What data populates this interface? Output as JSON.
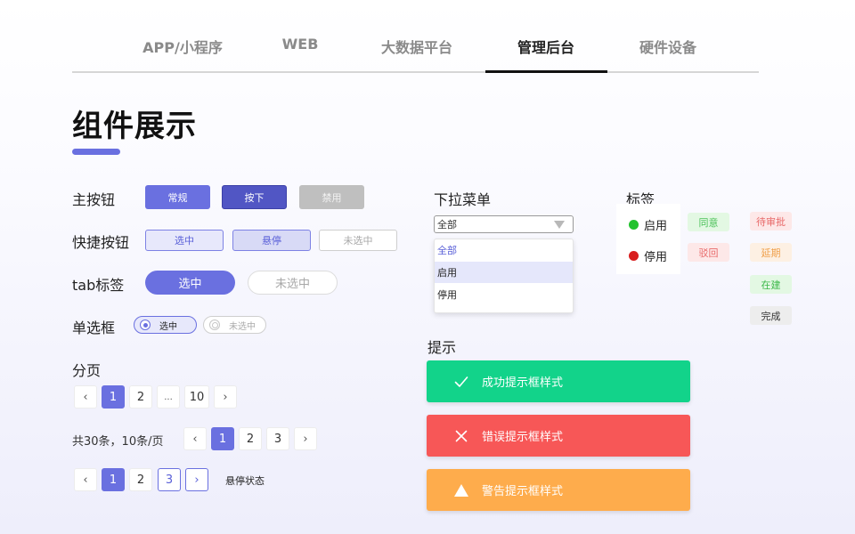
{
  "nav": {
    "tabs": [
      "APP/小程序",
      "WEB",
      "大数据平台",
      "管理后台",
      "硬件设备"
    ],
    "active_index": 3
  },
  "page_title": "组件展示",
  "primary_buttons": {
    "label": "主按钮",
    "items": [
      "常规",
      "按下",
      "禁用"
    ]
  },
  "shortcut_buttons": {
    "label": "快捷按钮",
    "items": [
      "选中",
      "悬停",
      "未选中"
    ]
  },
  "tab_tags": {
    "label": "tab标签",
    "items": [
      "选中",
      "未选中"
    ]
  },
  "radios": {
    "label": "单选框",
    "items": [
      "选中",
      "未选中"
    ]
  },
  "pagination": {
    "label": "分页",
    "row1": [
      "1",
      "2",
      "...",
      "10"
    ],
    "summary": "共30条，10条/页",
    "row2": [
      "1",
      "2",
      "3"
    ],
    "row3": [
      "1",
      "2",
      "3"
    ],
    "hover_label": "悬停状态"
  },
  "dropdown": {
    "label": "下拉菜单",
    "value": "全部",
    "options": [
      "全部",
      "启用",
      "停用"
    ]
  },
  "tags": {
    "label": "标签",
    "status": [
      {
        "text": "启用",
        "color": "#22c22e"
      },
      {
        "text": "停用",
        "color": "#d81e1e"
      }
    ],
    "approval": [
      {
        "text": "同意",
        "bg": "#e3f8e3",
        "fg": "#4cc25a"
      },
      {
        "text": "驳回",
        "bg": "#fde8e8",
        "fg": "#e86a6a"
      }
    ],
    "progress": [
      {
        "text": "待审批",
        "bg": "#fde8e8",
        "fg": "#e86a6a"
      },
      {
        "text": "延期",
        "bg": "#fdf0e3",
        "fg": "#f0a04b"
      },
      {
        "text": "在建",
        "bg": "#e3f8e3",
        "fg": "#3db84a"
      },
      {
        "text": "完成",
        "bg": "#ededed",
        "fg": "#333333"
      }
    ]
  },
  "alerts": {
    "label": "提示",
    "items": [
      {
        "text": "成功提示框样式",
        "icon": "check-icon",
        "color": "#12d38a"
      },
      {
        "text": "错误提示框样式",
        "icon": "close-icon",
        "color": "#f75757"
      },
      {
        "text": "警告提示框样式",
        "icon": "warning-icon",
        "color": "#feac4c"
      }
    ]
  },
  "colors": {
    "accent": "#6a70e0"
  }
}
